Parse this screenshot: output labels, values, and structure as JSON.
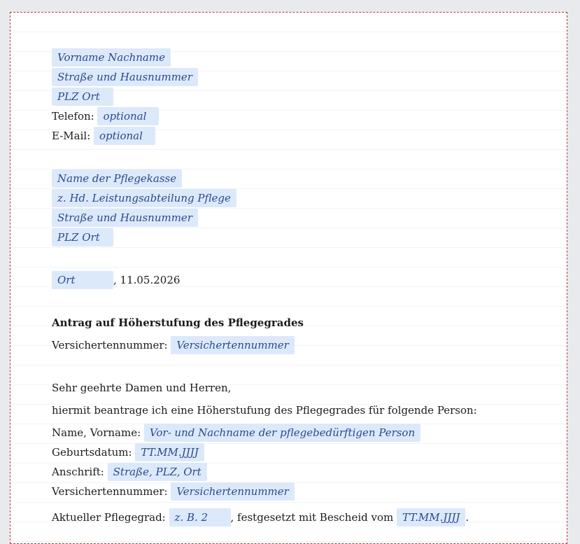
{
  "sender": {
    "name": "Vorname Nachname",
    "street": "Straße und Hausnummer",
    "city": "PLZ Ort",
    "phone_label": "Telefon:",
    "phone_value": "optional",
    "email_label": "E-Mail:",
    "email_value": "optional"
  },
  "recipient": {
    "name": "Name der Pflegekasse",
    "attention": "z. Hd. Leistungsabteilung Pflege",
    "street": "Straße und Hausnummer",
    "city": "PLZ Ort"
  },
  "place_date": {
    "place": "Ort",
    "date_text": ", 11.05.2026"
  },
  "subject": "Antrag auf Höherstufung des Pflegegrades",
  "insurance": {
    "label": "Versichertennummer:",
    "value": "Versichertennummer"
  },
  "salutation": "Sehr geehrte Damen und Herren,",
  "intro": "hiermit beantrage ich eine Höherstufung des Pflegegrades für folgende Person:",
  "person": {
    "name_label": "Name, Vorname:",
    "name_value": "Vor- und Nachname der pflegebedürftigen Person",
    "birth_label": "Geburtsdatum:",
    "birth_value": "TT.MM.JJJJ",
    "address_label": "Anschrift:",
    "address_value": "Straße, PLZ, Ort",
    "insurance_label": "Versichertennummer:",
    "insurance_value": "Versichertennummer"
  },
  "current_grade": {
    "label": "Aktueller Pflegegrad:",
    "value": "z. B. 2",
    "middle": ", festgesetzt mit Bescheid vom",
    "date": "TT.MM.JJJJ",
    "end": "."
  }
}
